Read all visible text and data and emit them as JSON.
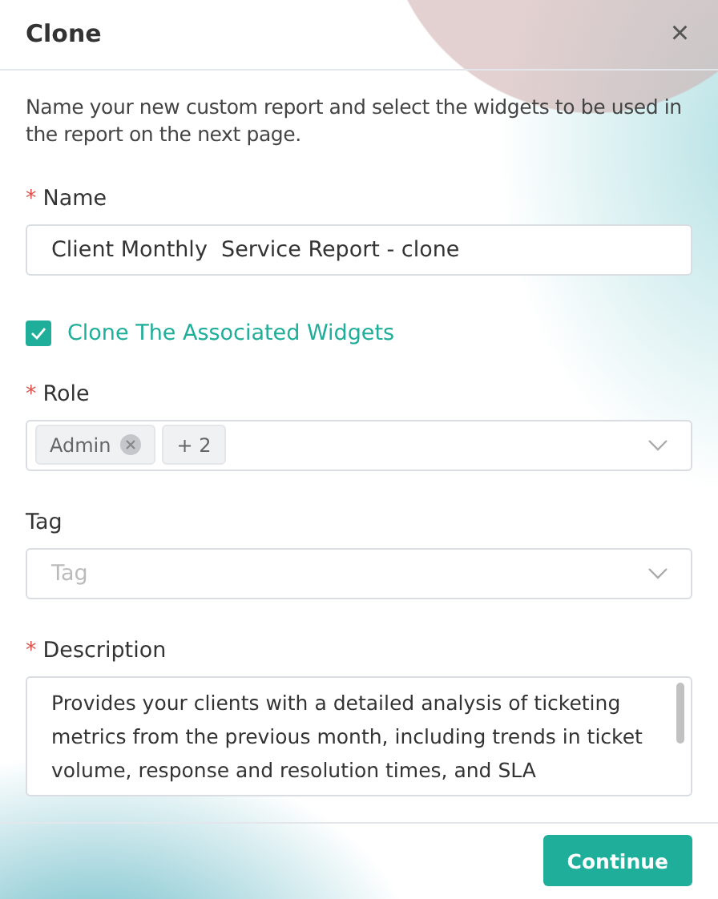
{
  "dialog": {
    "title": "Clone",
    "close": "×"
  },
  "intro": "Name your new custom report and select the widgets to be used in the report on the next page.",
  "fields": [
    {
      "kind": "text",
      "label": "Name",
      "marker": "*",
      "value": "Client Monthly  Service Report - clone"
    },
    {
      "kind": "checkbox",
      "label": "Clone The Associated Widgets",
      "checked": true
    },
    {
      "kind": "select",
      "label": "Role",
      "marker": "*",
      "tags": [
        {
          "label": "Admin",
          "removable": true
        },
        {
          "label": "+ 2",
          "removable": false
        }
      ]
    },
    {
      "kind": "select",
      "label": "Tag",
      "placeholder": "Tag"
    },
    {
      "kind": "textarea",
      "label": "Description",
      "marker": "*",
      "value": "Provides your clients with a detailed analysis of ticketing metrics from the previous month, including trends in ticket volume, response and resolution times, and SLA"
    }
  ],
  "footer": {
    "button": "Continue"
  }
}
